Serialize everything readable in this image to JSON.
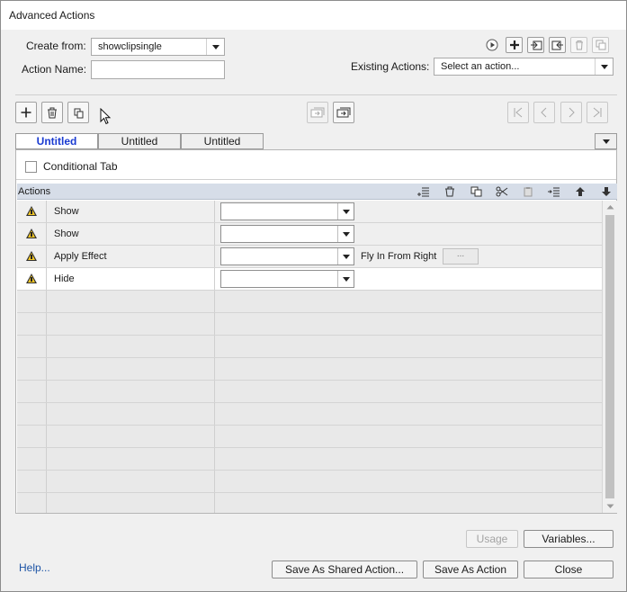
{
  "window": {
    "title": "Advanced Actions"
  },
  "form": {
    "create_from_label": "Create from:",
    "create_from_value": "showclipsingle",
    "action_name_label": "Action Name:",
    "action_name_value": "",
    "existing_actions_label": "Existing Actions:",
    "existing_actions_value": "Select an action..."
  },
  "tabs": [
    {
      "label": "Untitled",
      "active": true
    },
    {
      "label": "Untitled",
      "active": false
    },
    {
      "label": "Untitled",
      "active": false
    }
  ],
  "conditional_tab": {
    "label": "Conditional Tab",
    "checked": false
  },
  "actions_table": {
    "header": "Actions",
    "rows": [
      {
        "action": "Show",
        "warning": true,
        "value": "",
        "extra": ""
      },
      {
        "action": "Show",
        "warning": true,
        "value": "",
        "extra": ""
      },
      {
        "action": "Apply Effect",
        "warning": true,
        "value": "",
        "extra": "Fly In From Right",
        "ellipsis": "..."
      },
      {
        "action": "Hide",
        "warning": true,
        "value": "",
        "extra": ""
      }
    ],
    "empty_rows": 10
  },
  "buttons": {
    "usage": "Usage",
    "variables": "Variables...",
    "save_shared": "Save As Shared Action...",
    "save_action": "Save As Action",
    "close": "Close",
    "help": "Help..."
  },
  "colors": {
    "accent_tab": "#1a3bd1",
    "header_bg": "#d6dde8",
    "warning": "#f3c623",
    "link": "#1c53a5"
  }
}
